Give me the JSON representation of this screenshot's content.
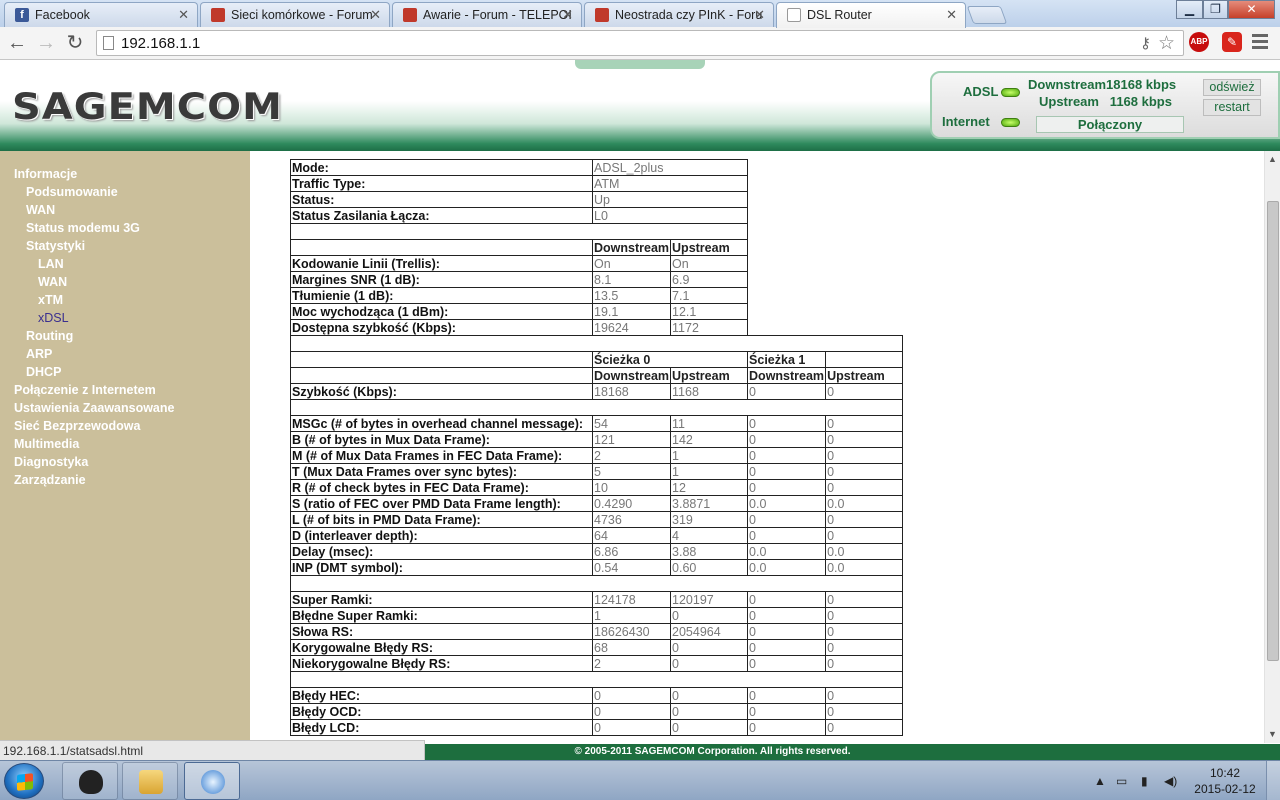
{
  "browser": {
    "tabs": [
      {
        "label": "Facebook",
        "favicon": "facebook-icon"
      },
      {
        "label": "Sieci komórkowe - Forum",
        "favicon": "forum-icon"
      },
      {
        "label": "Awarie - Forum - TELEPOI",
        "favicon": "forum-icon"
      },
      {
        "label": "Neostrada czy PInK - Foru",
        "favicon": "forum-icon"
      },
      {
        "label": "DSL Router",
        "favicon": "page-icon"
      }
    ],
    "url": "192.168.1.1",
    "ext_abp": "ABP",
    "status_url": "192.168.1.1/statsadsl.html"
  },
  "header": {
    "logo": "SAGEMCOM",
    "adsl_label": "ADSL",
    "internet_label": "Internet",
    "downstream": "Downstream18168 kbps",
    "upstream": "Upstream   1168 kbps",
    "refresh_button": "odśwież",
    "restart_button": "restart",
    "connection_state": "Połączony",
    "led_color": "#6fcf14"
  },
  "sidebar": {
    "items": [
      {
        "label": "Informacje"
      },
      {
        "label": "Podsumowanie"
      },
      {
        "label": "WAN"
      },
      {
        "label": "Status modemu 3G"
      },
      {
        "label": "Statystyki"
      },
      {
        "label": "LAN"
      },
      {
        "label": "WAN"
      },
      {
        "label": "xTM"
      },
      {
        "label": "xDSL"
      },
      {
        "label": "Routing"
      },
      {
        "label": "ARP"
      },
      {
        "label": "DHCP"
      },
      {
        "label": "Połączenie z Internetem"
      },
      {
        "label": "Ustawienia Zaawansowane"
      },
      {
        "label": "Sieć Bezprzewodowa"
      },
      {
        "label": "Multimedia"
      },
      {
        "label": "Diagnostyka"
      },
      {
        "label": "Zarządzanie"
      }
    ]
  },
  "stats": {
    "info": [
      {
        "label": "Mode:",
        "value": "ADSL_2plus"
      },
      {
        "label": "Traffic Type:",
        "value": "ATM"
      },
      {
        "label": "Status:",
        "value": "Up"
      },
      {
        "label": "Status Zasilania Łącza:",
        "value": "L0"
      }
    ],
    "line_headers": {
      "down": "Downstream",
      "up": "Upstream"
    },
    "line": [
      {
        "label": "Kodowanie Linii (Trellis):",
        "down": "On",
        "up": "On"
      },
      {
        "label": "Margines SNR (1 dB):",
        "down": "8.1",
        "up": "6.9"
      },
      {
        "label": "Tłumienie (1 dB):",
        "down": "13.5",
        "up": "7.1"
      },
      {
        "label": "Moc wychodząca (1 dBm):",
        "down": "19.1",
        "up": "12.1"
      },
      {
        "label": "Dostępna szybkość (Kbps):",
        "down": "19624",
        "up": "1172"
      }
    ],
    "path_headers": {
      "path0": "Ścieżka 0",
      "path1": "Ścieżka 1",
      "down": "Downstream",
      "up": "Upstream"
    },
    "speed": {
      "label": "Szybkość (Kbps):",
      "d0": "18168",
      "u0": "1168",
      "d1": "0",
      "u1": "0"
    },
    "framing": [
      {
        "label": "MSGc (# of bytes in overhead channel message):",
        "d0": "54",
        "u0": "11",
        "d1": "0",
        "u1": "0"
      },
      {
        "label": "B (# of bytes in Mux Data Frame):",
        "d0": "121",
        "u0": "142",
        "d1": "0",
        "u1": "0"
      },
      {
        "label": "M (# of Mux Data Frames in FEC Data Frame):",
        "d0": "2",
        "u0": "1",
        "d1": "0",
        "u1": "0"
      },
      {
        "label": "T (Mux Data Frames over sync bytes):",
        "d0": "5",
        "u0": "1",
        "d1": "0",
        "u1": "0"
      },
      {
        "label": "R (# of check bytes in FEC Data Frame):",
        "d0": "10",
        "u0": "12",
        "d1": "0",
        "u1": "0"
      },
      {
        "label": "S (ratio of FEC over PMD Data Frame length):",
        "d0": "0.4290",
        "u0": "3.8871",
        "d1": "0.0",
        "u1": "0.0"
      },
      {
        "label": "L (# of bits in PMD Data Frame):",
        "d0": "4736",
        "u0": "319",
        "d1": "0",
        "u1": "0"
      },
      {
        "label": "D (interleaver depth):",
        "d0": "64",
        "u0": "4",
        "d1": "0",
        "u1": "0"
      },
      {
        "label": "Delay (msec):",
        "d0": "6.86",
        "u0": "3.88",
        "d1": "0.0",
        "u1": "0.0"
      },
      {
        "label": "INP (DMT symbol):",
        "d0": "0.54",
        "u0": "0.60",
        "d1": "0.0",
        "u1": "0.0"
      }
    ],
    "counters": [
      {
        "label": "Super Ramki:",
        "d0": "124178",
        "u0": "120197",
        "d1": "0",
        "u1": "0"
      },
      {
        "label": "Błędne Super Ramki:",
        "d0": "1",
        "u0": "0",
        "d1": "0",
        "u1": "0"
      },
      {
        "label": "Słowa RS:",
        "d0": "18626430",
        "u0": "2054964",
        "d1": "0",
        "u1": "0"
      },
      {
        "label": "Korygowalne Błędy RS:",
        "d0": "68",
        "u0": "0",
        "d1": "0",
        "u1": "0"
      },
      {
        "label": "Niekorygowalne Błędy RS:",
        "d0": "2",
        "u0": "0",
        "d1": "0",
        "u1": "0"
      }
    ],
    "errors": [
      {
        "label": "Błędy HEC:",
        "d0": "0",
        "u0": "0",
        "d1": "0",
        "u1": "0"
      },
      {
        "label": "Błędy OCD:",
        "d0": "0",
        "u0": "0",
        "d1": "0",
        "u1": "0"
      },
      {
        "label": "Błędy LCD:",
        "d0": "0",
        "u0": "0",
        "d1": "0",
        "u1": "0"
      }
    ]
  },
  "footer": {
    "copyright": "© 2005-2011 SAGEMCOM Corporation. All rights reserved."
  },
  "taskbar": {
    "time": "10:42",
    "date": "2015-02-12"
  }
}
